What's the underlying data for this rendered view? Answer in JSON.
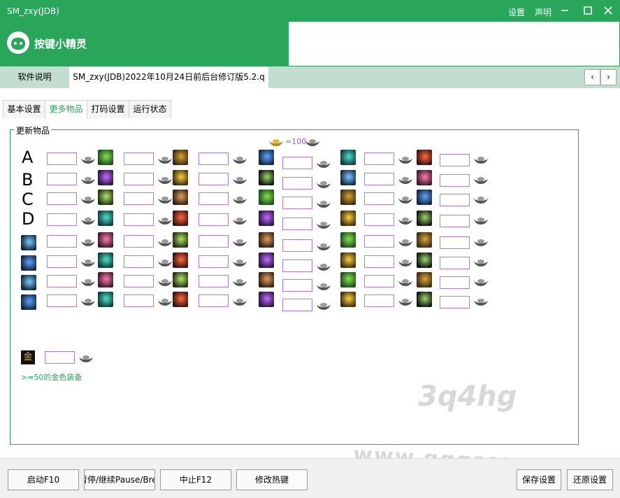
{
  "window": {
    "title": "SM_zxy(JDB)",
    "settings_label": "设置",
    "statement_label": "声明",
    "brand_name": "按键小精灵"
  },
  "top_tabs": [
    {
      "label": "软件说明"
    },
    {
      "label": "SM_zxy(JDB)2022年10月24日前后台修订版5.2.q"
    }
  ],
  "sub_tabs": [
    {
      "label": "基本设置"
    },
    {
      "label": "更多物品"
    },
    {
      "label": "打码设置"
    },
    {
      "label": "运行状态"
    }
  ],
  "group": {
    "legend": "更新物品",
    "price_note": "=100",
    "row_letters": [
      "A",
      "B",
      "C",
      "D"
    ],
    "gold_char": "金",
    "gold_note": ">=50的金色装备"
  },
  "buttons": {
    "start": "启动F10",
    "pause": "暂停/继续Pause/Break",
    "stop": "中止F12",
    "hotkey": "修改热键",
    "save": "保存设置",
    "restore": "还原设置"
  },
  "watermark": {
    "line1": "3q4hg",
    "line2": "www.qqgsss.com"
  },
  "colors": {
    "accent": "#2aa65a",
    "input_border": "#b77bcc",
    "note_text": "#2aa65a"
  }
}
